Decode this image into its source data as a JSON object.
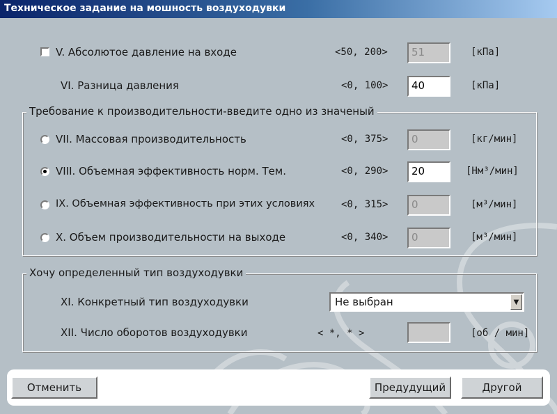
{
  "window": {
    "title": "Техническое задание на мошность воздуходувки"
  },
  "row5": {
    "label": "V. Абсолютое давление на входе",
    "range": "<50, 200>",
    "value": "51",
    "unit": "[кПа]",
    "checked": false
  },
  "row6": {
    "label": "VI. Разница давления",
    "range": "<0, 100>",
    "value": "40",
    "unit": "[кПа]"
  },
  "group1": {
    "legend": "Требование к производительности-введите одно из значеный",
    "rows": [
      {
        "label": "VII. Массовая производительность",
        "range": "<0, 375>",
        "value": "0",
        "unit": "[кг/мин]",
        "selected": false
      },
      {
        "label": "VIII. Объемная эффективность норм. Тем.",
        "range": "<0, 290>",
        "value": "20",
        "unit": "[Нм³/мин]",
        "selected": true
      },
      {
        "label": "IX. Объемная эффективность  при этих условиях",
        "range": "<0, 315>",
        "value": "0",
        "unit": "[м³/мин]",
        "selected": false
      },
      {
        "label": "X. Объем производительности на выходе",
        "range": "<0, 340>",
        "value": "0",
        "unit": "[м³/мин]",
        "selected": false
      }
    ]
  },
  "group2": {
    "legend": "Хочу определенный тип воздуходувки",
    "type": {
      "label": "XI. Конкретный тип воздуходувки",
      "selected": "Не выбран"
    },
    "rpm": {
      "label": "XII. Число оборотов воздуходувки",
      "range": "< *, * >",
      "value": "",
      "unit": "[об / мин]"
    }
  },
  "buttons": {
    "cancel": "Отменить",
    "prev": "Предудущий",
    "next": "Другой"
  }
}
